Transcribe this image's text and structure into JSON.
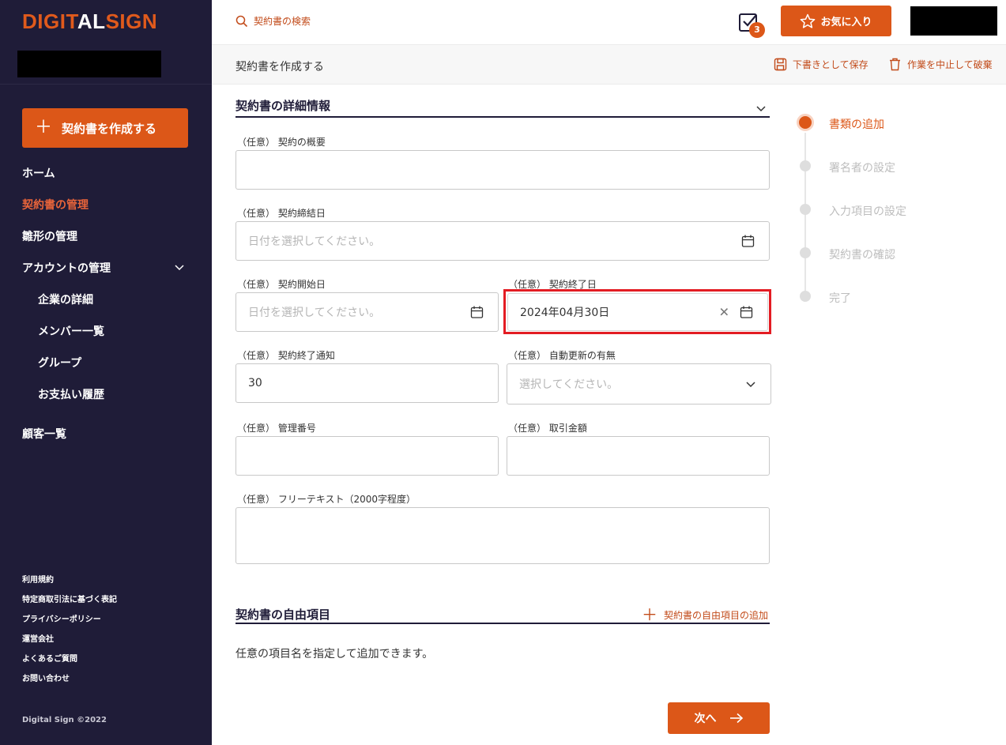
{
  "sidebar": {
    "logo_part1": "DIGIT",
    "logo_part2": "AL",
    "logo_part3": "SIGN",
    "create_button": "契約書を作成する",
    "nav": [
      {
        "label": "ホーム",
        "active": false
      },
      {
        "label": "契約書の管理",
        "active": true
      },
      {
        "label": "雛形の管理",
        "active": false
      },
      {
        "label": "アカウントの管理",
        "active": false,
        "expandable": true
      },
      {
        "label": "企業の詳細",
        "sub": true
      },
      {
        "label": "メンバー一覧",
        "sub": true
      },
      {
        "label": "グループ",
        "sub": true
      },
      {
        "label": "お支払い履歴",
        "sub": true
      },
      {
        "label": "顧客一覧",
        "active": false
      }
    ],
    "footer_links": [
      "利用規約",
      "特定商取引法に基づく表記",
      "プライバシーポリシー",
      "運営会社",
      "よくあるご質問",
      "お問い合わせ"
    ],
    "copyright": "Digital Sign ©2022"
  },
  "topbar": {
    "search_placeholder": "契約書の検索",
    "tasks_badge": "3",
    "favorite_button": "お気に入り"
  },
  "subbar": {
    "title": "契約書を作成する",
    "save_draft": "下書きとして保存",
    "discard": "作業を中止して破棄"
  },
  "details": {
    "section_title": "契約書の詳細情報",
    "summary_label": "（任意） 契約の概要",
    "summary_value": "",
    "conclusion_date_label": "（任意） 契約締結日",
    "conclusion_date_placeholder": "日付を選択してください。",
    "start_date_label": "（任意） 契約開始日",
    "start_date_placeholder": "日付を選択してください。",
    "end_date_label": "（任意） 契約終了日",
    "end_date_value": "2024年04月30日",
    "end_notice_label": "（任意） 契約終了通知",
    "end_notice_value": "30",
    "auto_renew_label": "（任意） 自動更新の有無",
    "auto_renew_placeholder": "選択してください。",
    "management_no_label": "（任意） 管理番号",
    "amount_label": "（任意） 取引金額",
    "free_text_label": "（任意） フリーテキスト（2000字程度）"
  },
  "free_items": {
    "section_title": "契約書の自由項目",
    "add_label": "契約書の自由項目の追加",
    "hint": "任意の項目名を指定して追加できます。"
  },
  "next_button": "次へ",
  "steps": [
    {
      "label": "書類の追加",
      "current": true
    },
    {
      "label": "署名者の設定",
      "current": false
    },
    {
      "label": "入力項目の設定",
      "current": false
    },
    {
      "label": "契約書の確認",
      "current": false
    },
    {
      "label": "完了",
      "current": false
    }
  ],
  "colors": {
    "accent": "#dc5718",
    "sidebar_bg": "#1f1c38",
    "highlight": "#e31c23"
  }
}
